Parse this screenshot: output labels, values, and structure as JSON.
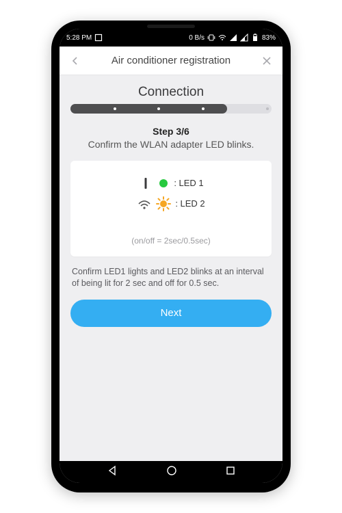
{
  "statusbar": {
    "time": "5:28 PM",
    "data_rate": "0 B/s",
    "battery": "83%"
  },
  "header": {
    "title": "Air conditioner registration"
  },
  "page": {
    "section": "Connection",
    "step_label": "Step 3/6",
    "step_desc": "Confirm the WLAN adapter LED blinks.",
    "led1_label": ": LED 1",
    "led2_label": ": LED 2",
    "timing_note": "(on/off = 2sec/0.5sec)",
    "explain": "Confirm LED1 lights and LED2 blinks at an interval of being lit for 2 sec and off for 0.5 sec.",
    "next": "Next"
  },
  "progress": {
    "current": 3,
    "total": 6,
    "percent": 78
  },
  "colors": {
    "accent": "#34aef2",
    "led1": "#27c93f",
    "led2": "#f5a623"
  }
}
